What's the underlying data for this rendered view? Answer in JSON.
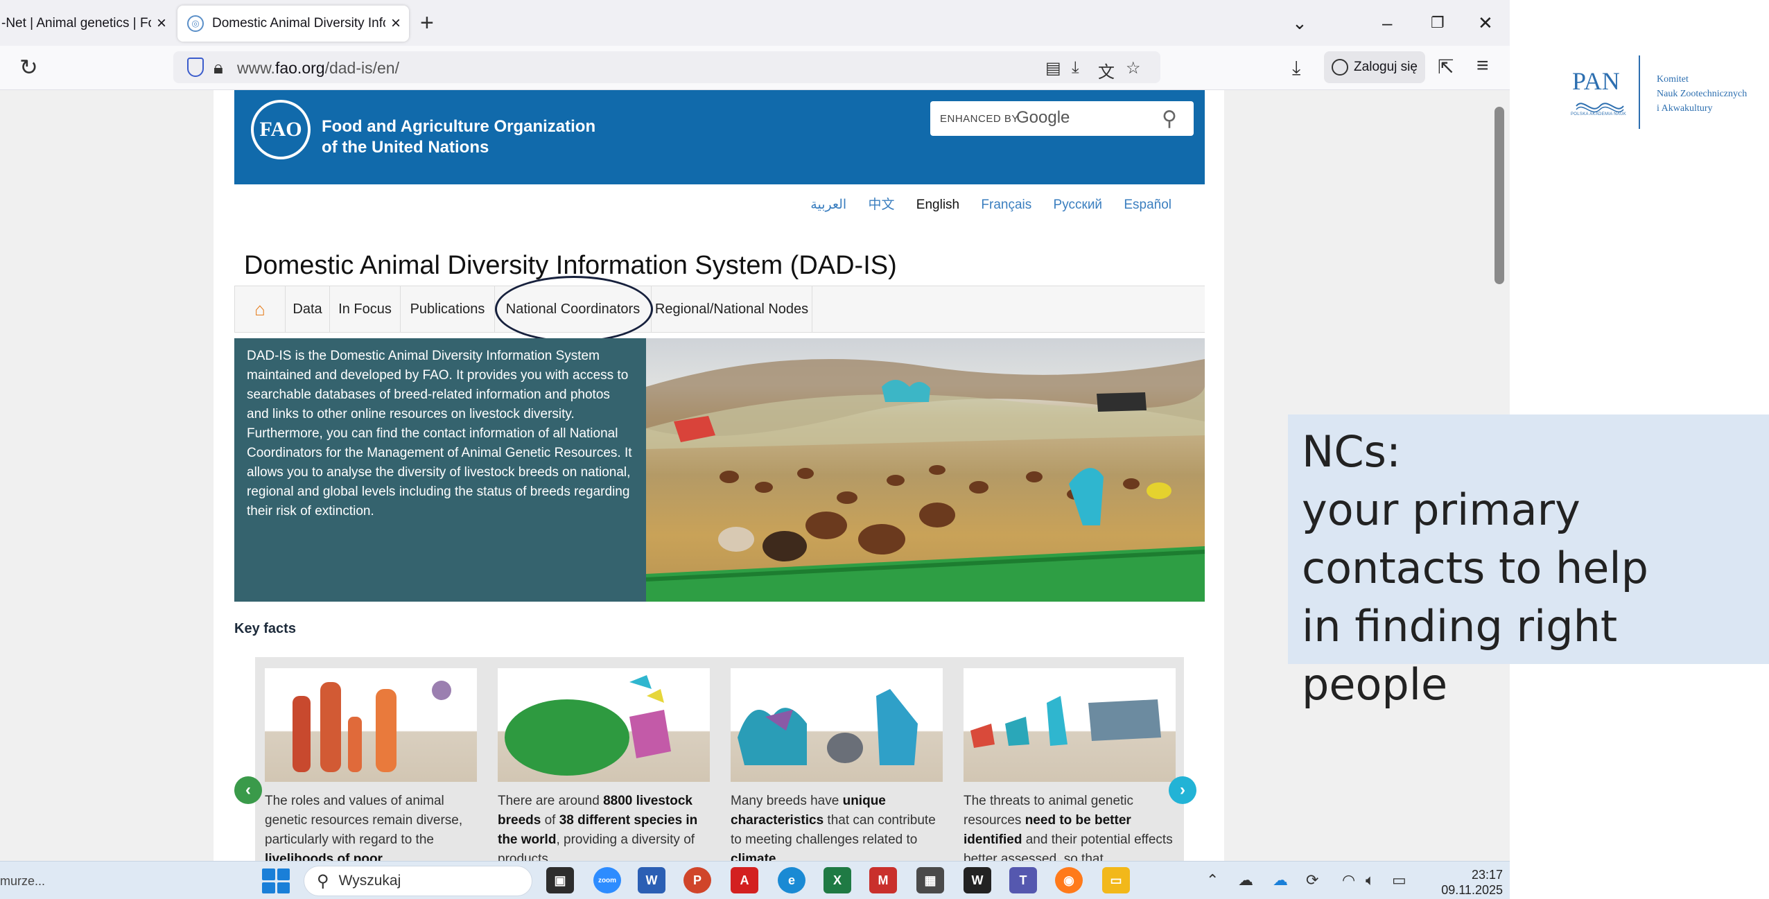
{
  "browser": {
    "tabs": [
      {
        "title": "-Net | Animal genetics | Foo",
        "active": false
      },
      {
        "title": "Domestic Animal Diversity Infor",
        "active": true
      }
    ],
    "url_prefix": "www.",
    "url_domain": "fao.org",
    "url_path": "/dad-is/en/",
    "login_label": "Zaloguj się"
  },
  "fao_header": {
    "logo_text": "FAO",
    "org_line1": "Food and Agriculture Organization",
    "org_line2": "of the United Nations",
    "search_enhanced": "ENHANCED BY",
    "search_google": "Google"
  },
  "languages": [
    "العربية",
    "中文",
    "English",
    "Français",
    "Русский",
    "Español"
  ],
  "active_language": "English",
  "page_title": "Domestic Animal Diversity Information System (DAD-IS)",
  "nav": {
    "home_icon": "⌂",
    "items": [
      "Data",
      "In Focus",
      "Publications",
      "National Coordinators",
      "Regional/National Nodes"
    ]
  },
  "hero_text": "DAD-IS is the Domestic Animal Diversity Information System maintained and developed by FAO. It provides you with access to searchable databases of breed-related information and photos and links to other online resources on livestock diversity. Furthermore, you can find the contact information of all National Coordinators for the Management of Animal Genetic Resources. It allows you to analyse the diversity of livestock breeds on national, regional and global levels including the status of breeds regarding their risk of extinction.",
  "key_facts_heading": "Key facts",
  "key_facts": [
    {
      "parts": [
        {
          "t": "The roles and values of animal genetic resources remain diverse, particularly with regard to the ",
          "b": false
        },
        {
          "t": "livelihoods of poor",
          "b": true
        }
      ]
    },
    {
      "parts": [
        {
          "t": "There are around ",
          "b": false
        },
        {
          "t": "8800 livestock breeds",
          "b": true
        },
        {
          "t": " of ",
          "b": false
        },
        {
          "t": "38 different species in the world",
          "b": true
        },
        {
          "t": ", providing a diversity of products",
          "b": false
        }
      ]
    },
    {
      "parts": [
        {
          "t": "Many breeds have ",
          "b": false
        },
        {
          "t": "unique characteristics",
          "b": true
        },
        {
          "t": " that can contribute to meeting challenges related to ",
          "b": false
        },
        {
          "t": "climate",
          "b": true
        }
      ]
    },
    {
      "parts": [
        {
          "t": "The threats to animal genetic resources ",
          "b": false
        },
        {
          "t": "need to be better identified",
          "b": true
        },
        {
          "t": " and their potential effects better assessed, so that",
          "b": false
        }
      ]
    }
  ],
  "taskbar": {
    "left_text": "murze...",
    "search_placeholder": "Wyszukaj",
    "time": "23:17",
    "date": "09.11.2025"
  },
  "slide": {
    "pan_logo_word": "PAN",
    "pan_logo_small": "POLSKA AKADEMIA NAUK",
    "committee": [
      "Komitet",
      "Nauk Zootechnicznych",
      "i Akwakultury"
    ],
    "callout": [
      "NCs:",
      "your primary",
      "contacts to help",
      "in finding right people"
    ]
  },
  "colors": {
    "fao_blue": "#116aab",
    "hero_teal": "#35636e",
    "nav_home_orange": "#e57b1a",
    "callout_bg": "#dbe6f3",
    "pan_blue": "#2d6fb0"
  }
}
